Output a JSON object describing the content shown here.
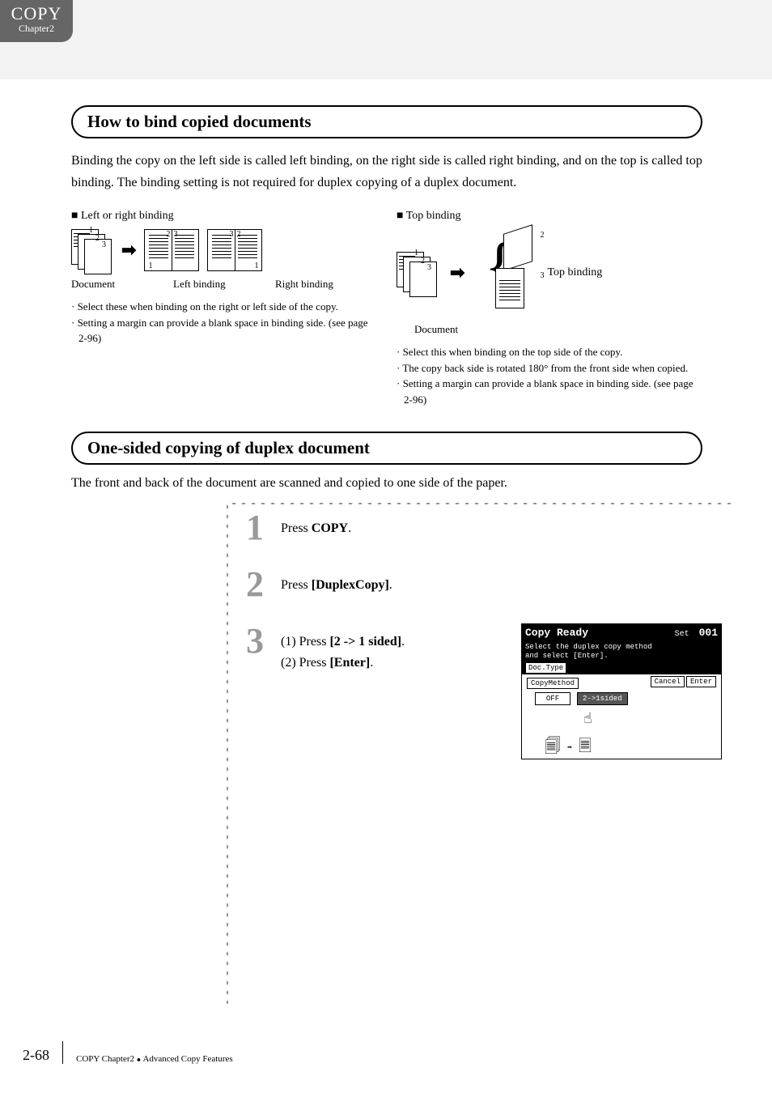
{
  "corner": {
    "big": "COPY",
    "small": "Chapter2"
  },
  "section1": {
    "heading": "How to bind copied documents",
    "intro": "Binding the copy on the left side is called left binding, on the right side is called right binding, and on the top is called top binding. The binding setting is not required for duplex copying of a duplex document.",
    "left_heading": "Left or right binding",
    "top_heading": "Top binding",
    "caption_document": "Document",
    "caption_left": "Left binding",
    "caption_right": "Right binding",
    "top_label": "Top binding",
    "left_notes": [
      "· Select these when binding on the right or left side of the copy.",
      "· Setting a margin can provide a blank space in binding side. (see page 2-96)"
    ],
    "top_notes": [
      "· Select this when binding on the top side of the copy.",
      "· The copy back side is rotated 180° from the front side when copied.",
      "· Setting a margin can provide a blank space in binding side. (see page 2-96)"
    ]
  },
  "section2": {
    "heading": "One-sided copying of duplex document",
    "intro": "The front and back of the document are scanned and copied to one side of the paper.",
    "steps": [
      {
        "num": "1",
        "lines": [
          "Press <b>COPY</b>."
        ]
      },
      {
        "num": "2",
        "lines": [
          "Press <b>[DuplexCopy]</b>."
        ]
      },
      {
        "num": "3",
        "lines": [
          "(1) Press <b>[2 -> 1 sided]</b>.",
          "(2) Press <b>[Enter]</b>."
        ]
      }
    ],
    "screen": {
      "title": "Copy Ready",
      "set_label": "Set",
      "set_value": "001",
      "subtitle": "Select the duplex copy method\nand select [Enter].",
      "tab": "Doc.Type",
      "panel_label": "CopyMethod",
      "cancel": "Cancel",
      "enter": "Enter",
      "option_off": "OFF",
      "option_sel": "2->1sided"
    }
  },
  "footer": {
    "page": "2-68",
    "trail": "COPY Chapter2",
    "section": "Advanced Copy Features"
  },
  "digits": {
    "d1": "1",
    "d2": "2",
    "d3": "3"
  }
}
